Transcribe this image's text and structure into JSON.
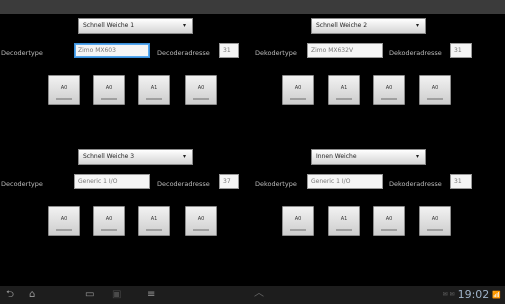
{
  "panels": [
    {
      "select": "Schnell Weiche 1",
      "type_label": "Decodertype",
      "type_value": "Zimo MX603",
      "addr_label": "Decoderadresse",
      "addr_value": "31",
      "buttons": [
        "A0",
        "A0",
        "A1",
        "A0"
      ]
    },
    {
      "select": "Schnell Weiche 2",
      "type_label": "Dekodertype",
      "type_value": "Zimo MX632V",
      "addr_label": "Dekoderadresse",
      "addr_value": "31",
      "buttons": [
        "A0",
        "A1",
        "A0",
        "A0"
      ]
    },
    {
      "select": "Schnell Weiche 3",
      "type_label": "Decodertype",
      "type_value": "Generic 1 I/O",
      "addr_label": "Decoderadresse",
      "addr_value": "37",
      "buttons": [
        "A0",
        "A0",
        "A1",
        "A0"
      ]
    },
    {
      "select": "Innen Weiche",
      "type_label": "Dekodertype",
      "type_value": "Generic 1 I/O",
      "addr_label": "Dekoderadresse",
      "addr_value": "31",
      "buttons": [
        "A0",
        "A1",
        "A0",
        "A0"
      ]
    }
  ],
  "icons": {
    "caret": "▾",
    "back": "⮌",
    "home": "⌂",
    "recent": "▭",
    "screenshot": "▣",
    "menu": "≡",
    "up": "︿",
    "notifications": "✉ ✉",
    "signal": "📶"
  },
  "status_bar": {
    "time": "19:02"
  }
}
